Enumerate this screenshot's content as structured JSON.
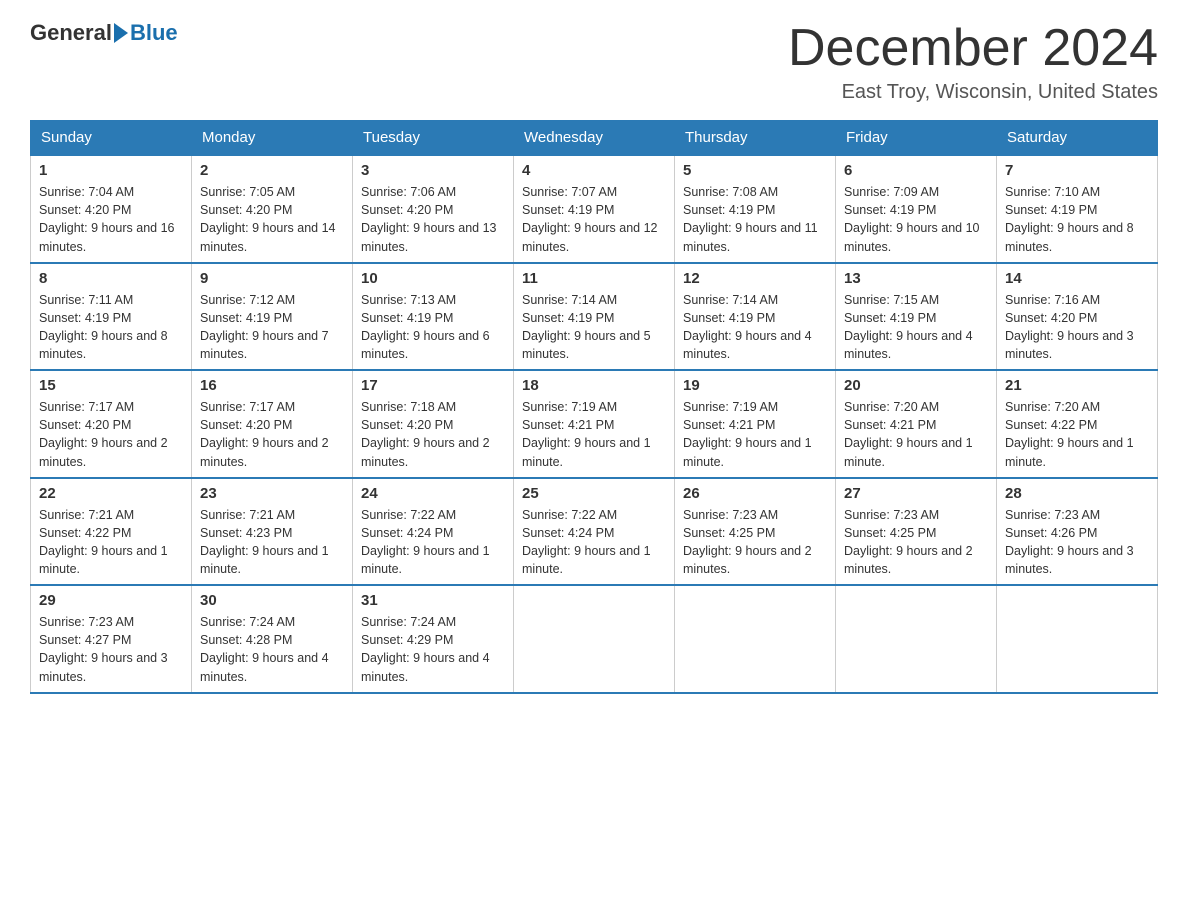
{
  "logo": {
    "general": "General",
    "blue": "Blue"
  },
  "title": "December 2024",
  "location": "East Troy, Wisconsin, United States",
  "days_of_week": [
    "Sunday",
    "Monday",
    "Tuesday",
    "Wednesday",
    "Thursday",
    "Friday",
    "Saturday"
  ],
  "weeks": [
    [
      {
        "day": "1",
        "sunrise": "7:04 AM",
        "sunset": "4:20 PM",
        "daylight": "9 hours and 16 minutes."
      },
      {
        "day": "2",
        "sunrise": "7:05 AM",
        "sunset": "4:20 PM",
        "daylight": "9 hours and 14 minutes."
      },
      {
        "day": "3",
        "sunrise": "7:06 AM",
        "sunset": "4:20 PM",
        "daylight": "9 hours and 13 minutes."
      },
      {
        "day": "4",
        "sunrise": "7:07 AM",
        "sunset": "4:19 PM",
        "daylight": "9 hours and 12 minutes."
      },
      {
        "day": "5",
        "sunrise": "7:08 AM",
        "sunset": "4:19 PM",
        "daylight": "9 hours and 11 minutes."
      },
      {
        "day": "6",
        "sunrise": "7:09 AM",
        "sunset": "4:19 PM",
        "daylight": "9 hours and 10 minutes."
      },
      {
        "day": "7",
        "sunrise": "7:10 AM",
        "sunset": "4:19 PM",
        "daylight": "9 hours and 8 minutes."
      }
    ],
    [
      {
        "day": "8",
        "sunrise": "7:11 AM",
        "sunset": "4:19 PM",
        "daylight": "9 hours and 8 minutes."
      },
      {
        "day": "9",
        "sunrise": "7:12 AM",
        "sunset": "4:19 PM",
        "daylight": "9 hours and 7 minutes."
      },
      {
        "day": "10",
        "sunrise": "7:13 AM",
        "sunset": "4:19 PM",
        "daylight": "9 hours and 6 minutes."
      },
      {
        "day": "11",
        "sunrise": "7:14 AM",
        "sunset": "4:19 PM",
        "daylight": "9 hours and 5 minutes."
      },
      {
        "day": "12",
        "sunrise": "7:14 AM",
        "sunset": "4:19 PM",
        "daylight": "9 hours and 4 minutes."
      },
      {
        "day": "13",
        "sunrise": "7:15 AM",
        "sunset": "4:19 PM",
        "daylight": "9 hours and 4 minutes."
      },
      {
        "day": "14",
        "sunrise": "7:16 AM",
        "sunset": "4:20 PM",
        "daylight": "9 hours and 3 minutes."
      }
    ],
    [
      {
        "day": "15",
        "sunrise": "7:17 AM",
        "sunset": "4:20 PM",
        "daylight": "9 hours and 2 minutes."
      },
      {
        "day": "16",
        "sunrise": "7:17 AM",
        "sunset": "4:20 PM",
        "daylight": "9 hours and 2 minutes."
      },
      {
        "day": "17",
        "sunrise": "7:18 AM",
        "sunset": "4:20 PM",
        "daylight": "9 hours and 2 minutes."
      },
      {
        "day": "18",
        "sunrise": "7:19 AM",
        "sunset": "4:21 PM",
        "daylight": "9 hours and 1 minute."
      },
      {
        "day": "19",
        "sunrise": "7:19 AM",
        "sunset": "4:21 PM",
        "daylight": "9 hours and 1 minute."
      },
      {
        "day": "20",
        "sunrise": "7:20 AM",
        "sunset": "4:21 PM",
        "daylight": "9 hours and 1 minute."
      },
      {
        "day": "21",
        "sunrise": "7:20 AM",
        "sunset": "4:22 PM",
        "daylight": "9 hours and 1 minute."
      }
    ],
    [
      {
        "day": "22",
        "sunrise": "7:21 AM",
        "sunset": "4:22 PM",
        "daylight": "9 hours and 1 minute."
      },
      {
        "day": "23",
        "sunrise": "7:21 AM",
        "sunset": "4:23 PM",
        "daylight": "9 hours and 1 minute."
      },
      {
        "day": "24",
        "sunrise": "7:22 AM",
        "sunset": "4:24 PM",
        "daylight": "9 hours and 1 minute."
      },
      {
        "day": "25",
        "sunrise": "7:22 AM",
        "sunset": "4:24 PM",
        "daylight": "9 hours and 1 minute."
      },
      {
        "day": "26",
        "sunrise": "7:23 AM",
        "sunset": "4:25 PM",
        "daylight": "9 hours and 2 minutes."
      },
      {
        "day": "27",
        "sunrise": "7:23 AM",
        "sunset": "4:25 PM",
        "daylight": "9 hours and 2 minutes."
      },
      {
        "day": "28",
        "sunrise": "7:23 AM",
        "sunset": "4:26 PM",
        "daylight": "9 hours and 3 minutes."
      }
    ],
    [
      {
        "day": "29",
        "sunrise": "7:23 AM",
        "sunset": "4:27 PM",
        "daylight": "9 hours and 3 minutes."
      },
      {
        "day": "30",
        "sunrise": "7:24 AM",
        "sunset": "4:28 PM",
        "daylight": "9 hours and 4 minutes."
      },
      {
        "day": "31",
        "sunrise": "7:24 AM",
        "sunset": "4:29 PM",
        "daylight": "9 hours and 4 minutes."
      },
      null,
      null,
      null,
      null
    ]
  ]
}
